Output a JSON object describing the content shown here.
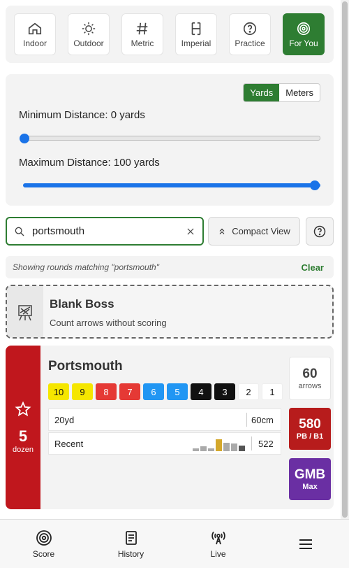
{
  "filters": [
    {
      "label": "Indoor",
      "icon": "home-icon"
    },
    {
      "label": "Outdoor",
      "icon": "sun-icon"
    },
    {
      "label": "Metric",
      "icon": "hash-icon"
    },
    {
      "label": "Imperial",
      "icon": "ruler-icon"
    },
    {
      "label": "Practice",
      "icon": "question-circle-icon"
    },
    {
      "label": "For You",
      "icon": "target-icon",
      "active": true
    }
  ],
  "distance": {
    "units": [
      "Yards",
      "Meters"
    ],
    "selected_unit": "Yards",
    "min_label": "Minimum Distance: 0 yards",
    "max_label": "Maximum Distance: 100 yards",
    "min_value": 0,
    "max_value": 100
  },
  "search": {
    "value": "portsmouth",
    "compact_label": "Compact View"
  },
  "match": {
    "text": "Showing rounds matching \"portsmouth\"",
    "clear_label": "Clear"
  },
  "blank": {
    "title": "Blank Boss",
    "subtitle": "Count arrows without scoring"
  },
  "round": {
    "name": "Portsmouth",
    "dozen_value": "5",
    "dozen_label": "dozen",
    "rings": [
      "10",
      "9",
      "8",
      "7",
      "6",
      "5",
      "4",
      "3",
      "2",
      "1"
    ],
    "ring_colors": [
      "#f5e600",
      "#f5e600",
      "#e53935",
      "#e53935",
      "#2196f3",
      "#2196f3",
      "#111111",
      "#111111",
      "#ffffff",
      "#ffffff"
    ],
    "distance_left": "20yd",
    "distance_right": "60cm",
    "recent_label": "Recent",
    "recent_value": "522",
    "arrows_value": "60",
    "arrows_label": "arrows",
    "pb_value": "580",
    "pb_label": "PB / B1",
    "class_value": "GMB",
    "class_label": "Max",
    "pb_color": "#b71c1c",
    "class_color": "#6a2fa3"
  },
  "nav": [
    {
      "label": "Score",
      "icon": "target-icon"
    },
    {
      "label": "History",
      "icon": "notepad-icon"
    },
    {
      "label": "Live",
      "icon": "broadcast-icon"
    },
    {
      "label": "",
      "icon": "menu-icon"
    }
  ]
}
